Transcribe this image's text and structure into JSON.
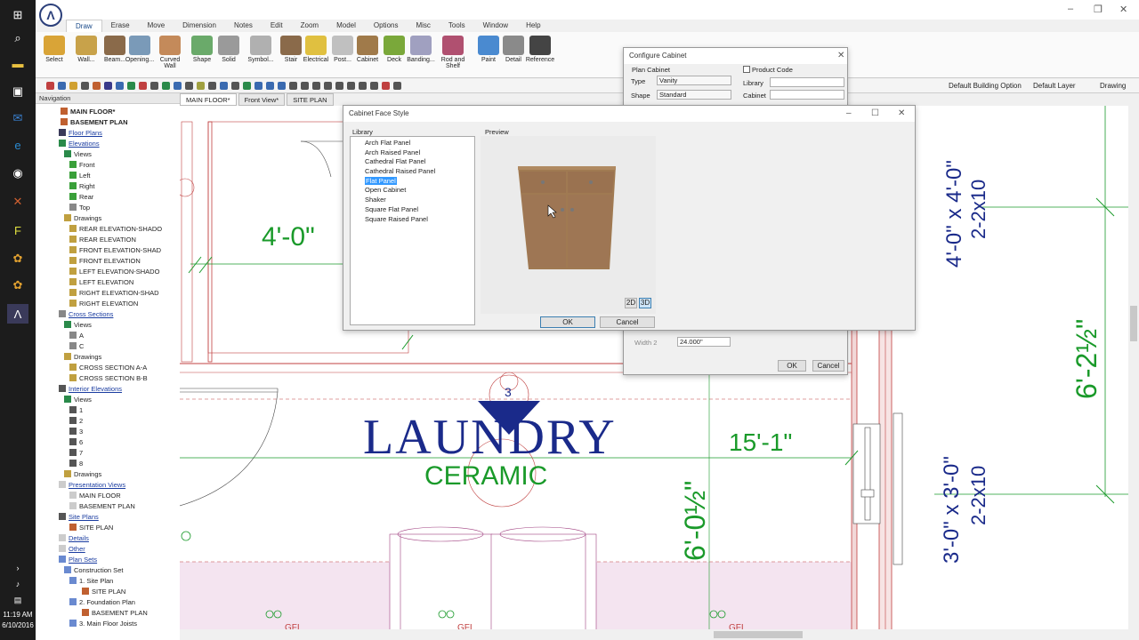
{
  "taskbar": {
    "time": "11:19 AM",
    "date": "6/10/2016"
  },
  "menus": [
    "Draw",
    "Erase",
    "Move",
    "Dimension",
    "Notes",
    "Edit",
    "Zoom",
    "Model",
    "Options",
    "Misc",
    "Tools",
    "Window",
    "Help"
  ],
  "ribbon": [
    {
      "label": "Select",
      "color": "#d9a437"
    },
    {
      "label": "Wall...",
      "color": "#c8a24a"
    },
    {
      "label": "Beam...",
      "color": "#8a6a4a"
    },
    {
      "label": "Opening...",
      "color": "#7a9ab8"
    },
    {
      "label": "Curved Wall",
      "color": "#c48a5a"
    },
    {
      "label": "Shape",
      "color": "#6aaa6a"
    },
    {
      "label": "Solid",
      "color": "#9a9a9a"
    },
    {
      "label": "Symbol...",
      "color": "#b0b0b0"
    },
    {
      "label": "Stair",
      "color": "#8a6a4a"
    },
    {
      "label": "Electrical",
      "color": "#e0c040"
    },
    {
      "label": "Post...",
      "color": "#c0c0c0"
    },
    {
      "label": "Cabinet",
      "color": "#a07a4a"
    },
    {
      "label": "Deck",
      "color": "#7aa83a"
    },
    {
      "label": "Banding...",
      "color": "#a0a0c0"
    },
    {
      "label": "Rod and Shelf",
      "color": "#b05070"
    },
    {
      "label": "Paint",
      "color": "#4a8ad0"
    },
    {
      "label": "Detail",
      "color": "#8a8a8a"
    },
    {
      "label": "Reference",
      "color": "#444444"
    }
  ],
  "defaults": {
    "option": "Default Building Option",
    "layer": "Default Layer",
    "type": "Drawing"
  },
  "navigation": {
    "title": "Navigation",
    "items": [
      {
        "label": "MAIN FLOOR*",
        "bold": true
      },
      {
        "label": "BASEMENT PLAN",
        "bold": true
      },
      {
        "label": "Floor Plans",
        "link": true
      },
      {
        "label": "Elevations",
        "link": true
      },
      {
        "label": "Views"
      },
      {
        "label": "Front"
      },
      {
        "label": "Left"
      },
      {
        "label": "Right"
      },
      {
        "label": "Rear"
      },
      {
        "label": "Top"
      },
      {
        "label": "Drawings"
      },
      {
        "label": "REAR ELEVATION-SHADO"
      },
      {
        "label": "REAR ELEVATION"
      },
      {
        "label": "FRONT ELEVATION-SHAD"
      },
      {
        "label": "FRONT ELEVATION"
      },
      {
        "label": "LEFT ELEVATION-SHADO"
      },
      {
        "label": "LEFT ELEVATION"
      },
      {
        "label": "RIGHT ELEVATION-SHAD"
      },
      {
        "label": "RIGHT ELEVATION"
      },
      {
        "label": "Cross Sections",
        "link": true
      },
      {
        "label": "Views"
      },
      {
        "label": "A"
      },
      {
        "label": "C"
      },
      {
        "label": "Drawings"
      },
      {
        "label": "CROSS SECTION A-A"
      },
      {
        "label": "CROSS SECTION B-B"
      },
      {
        "label": "Interior Elevations",
        "link": true
      },
      {
        "label": "Views"
      },
      {
        "label": "1"
      },
      {
        "label": "2"
      },
      {
        "label": "3"
      },
      {
        "label": "6"
      },
      {
        "label": "7"
      },
      {
        "label": "8"
      },
      {
        "label": "Drawings"
      },
      {
        "label": "Presentation Views",
        "link": true
      },
      {
        "label": "MAIN FLOOR"
      },
      {
        "label": "BASEMENT PLAN"
      },
      {
        "label": "Site Plans",
        "link": true
      },
      {
        "label": "SITE PLAN"
      },
      {
        "label": "Details",
        "link": true
      },
      {
        "label": "Other",
        "link": true
      },
      {
        "label": "Plan Sets",
        "link": true
      },
      {
        "label": "Construction Set"
      },
      {
        "label": "1. Site Plan"
      },
      {
        "label": "SITE PLAN"
      },
      {
        "label": "2. Foundation Plan"
      },
      {
        "label": "BASEMENT PLAN"
      },
      {
        "label": "3. Main Floor Joists"
      }
    ]
  },
  "tabs": [
    "MAIN FLOOR*",
    "Front View*",
    "SITE PLAN"
  ],
  "drawing": {
    "room_name": "LAUNDRY",
    "material": "CERAMIC",
    "dims": [
      "4'-0\"",
      "15'-1\"",
      "6'-0½\"",
      "6'-2½\""
    ],
    "window1_size": "4'-0\" x 4'-0\"",
    "window1_header": "2-2x10",
    "window2_size": "3'-0\" x 3'-0\"",
    "window2_header": "2-2x10",
    "marker": "3",
    "gfi": "GFI"
  },
  "configure_cabinet": {
    "title": "Configure Cabinet",
    "section": "Plan Cabinet",
    "type_label": "Type",
    "type_value": "Vanity",
    "shape_label": "Shape",
    "shape_value": "Standard",
    "product_code": "Product Code",
    "library": "Library",
    "cabinet": "Cabinet",
    "width2_label": "Width 2",
    "width2_value": "24.000\"",
    "ok": "OK",
    "cancel": "Cancel"
  },
  "face_style": {
    "title": "Cabinet Face Style",
    "library_label": "Library",
    "preview_label": "Preview",
    "items": [
      "Arch Flat Panel",
      "Arch Raised Panel",
      "Cathedral Flat Panel",
      "Cathedral Raised Panel",
      "Flat Panel",
      "Open Cabinet",
      "Shaker",
      "Square Flat Panel",
      "Square Raised Panel"
    ],
    "selected": "Flat Panel",
    "btn_2d": "2D",
    "btn_3d": "3D",
    "ok": "OK",
    "cancel": "Cancel"
  },
  "colors": {
    "plan_green": "#1a9a2a",
    "plan_blue": "#1a2a8a",
    "wall_red": "#c04040",
    "laundry_fill": "#f4e4f0"
  }
}
